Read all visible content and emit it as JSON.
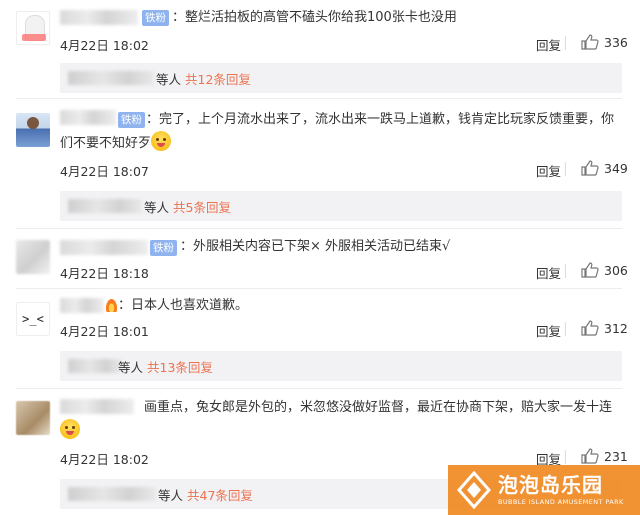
{
  "comments": [
    {
      "badge": "铁粉",
      "text": "整烂活拍板的高管不磕头你给我100张卡也没用",
      "time": "4月22日 18:02",
      "reply": "回复",
      "likes": "336",
      "thread": {
        "prefix": "等人",
        "link": "共12条回复"
      }
    },
    {
      "badge": "铁粉",
      "text": "：完了，上个月流水出来了，流水出来一跌马上道歉，钱肯定比玩家反馈重要，你们不要不知好歹",
      "time": "4月22日 18:07",
      "reply": "回复",
      "likes": "349",
      "thread": {
        "prefix": "等人",
        "link": "共5条回复"
      }
    },
    {
      "badge": "铁粉",
      "text": "：外服相关内容已下架× 外服相关活动已结束√",
      "time": "4月22日 18:18",
      "reply": "回复",
      "likes": "306"
    },
    {
      "avatar_text": ">_<",
      "text": "：日本人也喜欢道歉。",
      "time": "4月22日 18:01",
      "reply": "回复",
      "likes": "312",
      "thread": {
        "prefix": "等人",
        "link": "共13条回复"
      }
    },
    {
      "text": "画重点，兔女郎是外包的，米忽悠没做好监督，最近在协商下架，赔大家一发十连",
      "time": "4月22日 18:02",
      "reply": "回复",
      "likes": "231",
      "thread": {
        "prefix": "等人",
        "link": "共47条回复"
      }
    }
  ],
  "watermark": {
    "title": "泡泡岛乐园",
    "subtitle": "BUBBLE ISLAND AMUSEMENT PARK"
  },
  "colors": {
    "link": "#eb7350",
    "badge": "#8fb3ee",
    "reply_bg": "#f2f2f5",
    "watermark": "#f18a22"
  }
}
